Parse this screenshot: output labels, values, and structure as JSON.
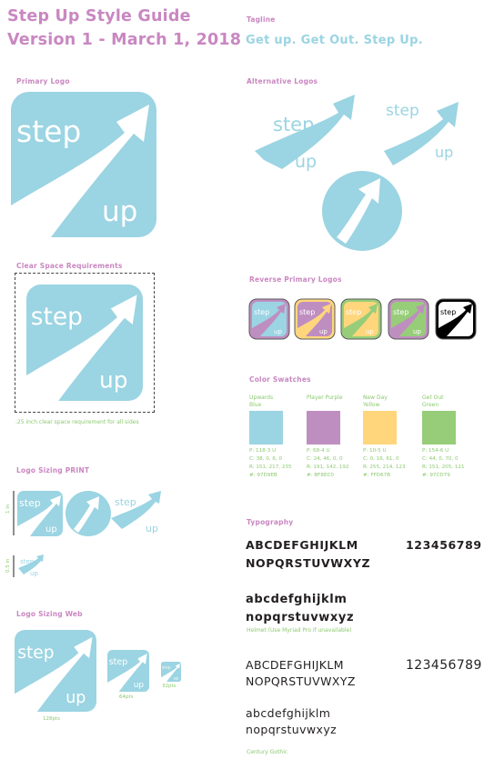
{
  "header": {
    "title_line1": "Step Up Style Guide",
    "title_line2": "Version 1 - March 1, 2018"
  },
  "tagline": {
    "heading": "Tagline",
    "text": "Get up. Get Out. Step Up."
  },
  "sections": {
    "primary_logo": "Primary Logo",
    "alternative_logos": "Alternative Logos",
    "clear_space": "Clear Space Requirements",
    "clear_space_note": ".25 inch clear space requirement for all sides",
    "reverse_logos": "Reverse Primary Logos",
    "color_swatches": "Color Swatches",
    "sizing_print": "Logo Sizing PRINT",
    "sizing_web": "Logo Sizing Web",
    "typography": "Typography"
  },
  "logo": {
    "word1": "step",
    "word2": "up"
  },
  "print_sizes": {
    "large": "1 in",
    "small": "0.5 in"
  },
  "web_sizes": [
    "128pts",
    "64pts",
    "32pts"
  ],
  "colors": {
    "blue": "#9bd4e2",
    "purple": "#bf8ec0",
    "yellow": "#ffd67b",
    "green": "#97cd79",
    "black": "#000000"
  },
  "swatches": [
    {
      "name": "Upwards Blue",
      "color": "#9bd4e2",
      "p": "P: 118-3 U",
      "c": "C: 38, 0, 6, 0",
      "r": "R: 151, 217, 235",
      "hex": "#: 97D9EB"
    },
    {
      "name": "Player Purple",
      "color": "#bf8ec0",
      "p": "P: 68-4 U",
      "c": "C: 24, 46, 0, 0",
      "r": "R: 191, 142, 192",
      "hex": "#: BF8EC0"
    },
    {
      "name": "New Day Yellow",
      "color": "#ffd67b",
      "p": "P: 10-5 U",
      "c": "C: 0, 16, 61, 0",
      "r": "R: 255, 214, 123",
      "hex": "#: FFD67B"
    },
    {
      "name": "Get Out Green",
      "color": "#97cd79",
      "p": "P: 154-6 U",
      "c": "C: 44, 0, 70, 0",
      "r": "R: 151, 205, 121",
      "hex": "#: 97CD79"
    }
  ],
  "typography": {
    "upper": "ABCDEFGHIJKLM",
    "upper2": "NOPQRSTUVWXYZ",
    "digits": "123456789",
    "lower": "abcdefghijklm",
    "lower2": "nopqrstuvwxyz",
    "font1_note": "Helmet (Use Myriad Pro if unavailable)",
    "font2_note": "Century Gothic"
  }
}
